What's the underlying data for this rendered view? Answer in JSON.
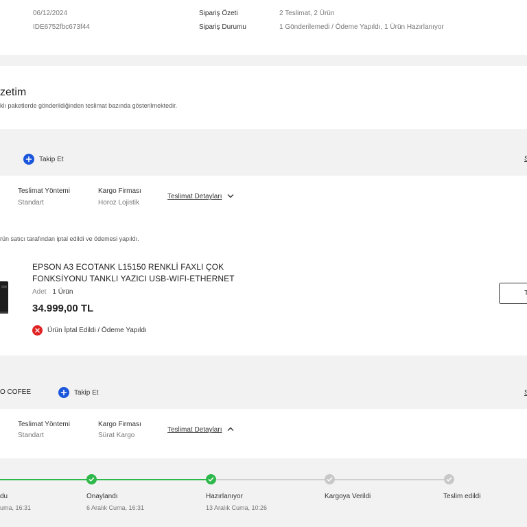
{
  "order": {
    "date": "06/12/2024",
    "id": "IDE6752fbc673f44",
    "summary_label": "Sipariş Özeti",
    "summary_value": "2 Teslimat, 2 Ürün",
    "status_label": "Sipariş Durumu",
    "status_value": "1 Gönderilemedi / Ödeme Yapıldı, 1 Ürün Hazırlanıyor"
  },
  "section": {
    "title": "zetim",
    "subtitle": "klı paketlerde gönderildiğinden teslimat bazında gösterilmektedir."
  },
  "delivery1": {
    "follow_label": "Takip Et",
    "right_cut": "S",
    "method_label": "Teslimat Yöntemi",
    "method_value": "Standart",
    "cargo_label": "Kargo Firması",
    "cargo_value": "Horoz Lojistik",
    "details_link": "Teslimat Detayları",
    "notice": "rün satıcı tarafından iptal edildi ve ödemesi yapıldı.",
    "product_name": "EPSON A3 ECOTANK L15150 RENKLİ FAXLI ÇOK FONKSİYONU TANKLI YAZICI USB-WIFI-ETHERNET",
    "qty_label": "Adet",
    "qty_value": "1 Ürün",
    "price": "34.999,00 TL",
    "status": "Ürün İptal Edildi / Ödeme Yapıldı",
    "button_cut": "T"
  },
  "delivery2": {
    "seller": "O COFEE",
    "follow_label": "Takip Et",
    "right_cut": "S",
    "method_label": "Teslimat Yöntemi",
    "method_value": "Standart",
    "cargo_label": "Kargo Firması",
    "cargo_value": "Sürat Kargo",
    "details_link": "Teslimat Detayları"
  },
  "tracking": {
    "steps": [
      {
        "title": "du",
        "date": "uma, 16:31",
        "done": true
      },
      {
        "title": "Onaylandı",
        "date": "6 Aralık Cuma, 16:31",
        "done": true
      },
      {
        "title": "Hazırlanıyor",
        "date": "13 Aralık Cuma, 10:26",
        "done": true
      },
      {
        "title": "Kargoya Verildi",
        "date": "",
        "done": false
      },
      {
        "title": "Teslim edildi",
        "date": "",
        "done": false
      }
    ]
  },
  "colors": {
    "accent_blue": "#1a56db",
    "success_green": "#2eb84b",
    "error_red": "#e02424",
    "pending_gray": "#c8c8c8"
  },
  "icons": [
    "plus-icon",
    "chevron-down-icon",
    "chevron-up-icon",
    "close-icon",
    "check-icon",
    "printer-image"
  ]
}
